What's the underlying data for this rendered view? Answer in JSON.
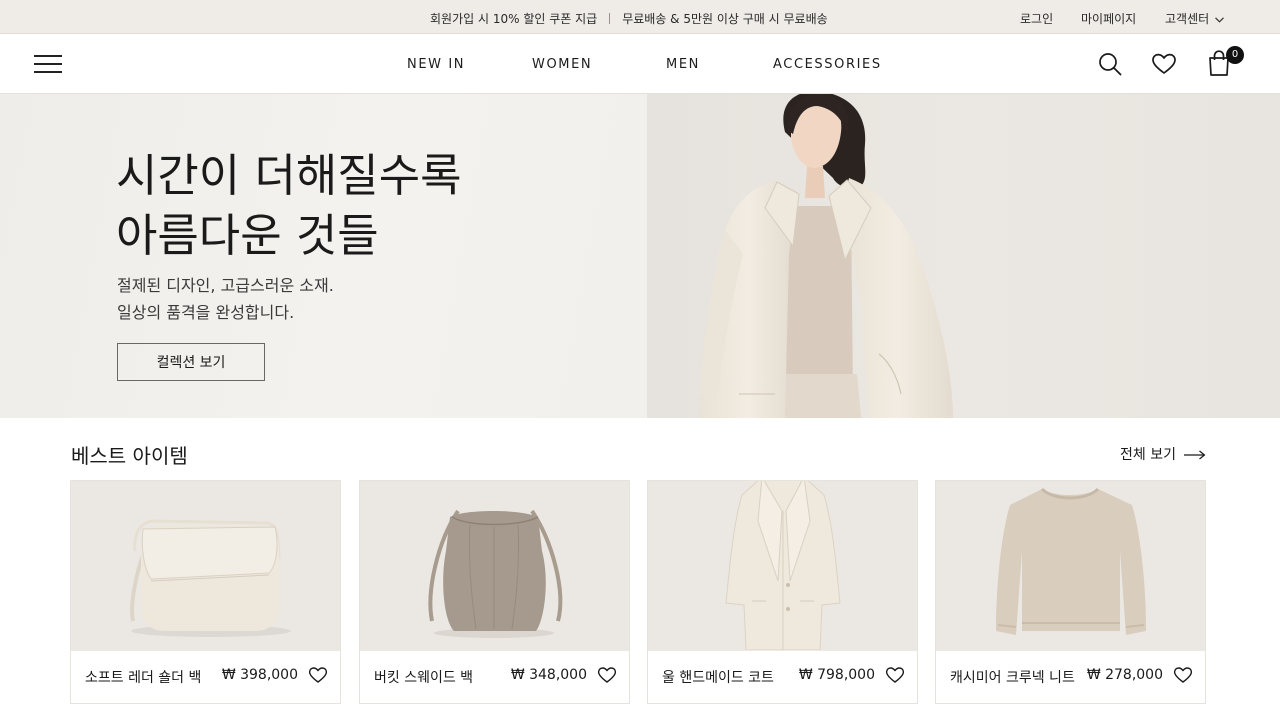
{
  "topbar": {
    "promo_coupon": "회원가입 시 10% 할인 쿠폰 지급",
    "promo_shipping": "무료배송 & 5만원 이상 구매 시 무료배송",
    "login": "로그인",
    "mypage": "마이페이지",
    "customer_center": "고객센터"
  },
  "nav": {
    "items": [
      "NEW IN",
      "WOMEN",
      "MEN",
      "ACCESSORIES"
    ],
    "cart_count": "0"
  },
  "hero": {
    "title_line1": "시간이 더해질수록",
    "title_line2": "아름다운 것들",
    "sub_line1": "절제된 디자인, 고급스러운 소재.",
    "sub_line2": "일상의 품격을 완성합니다.",
    "cta": "컬렉션 보기"
  },
  "best": {
    "title": "베스트 아이템",
    "view_all": "전체 보기",
    "products": [
      {
        "name": "소프트 레더 숄더 백",
        "price": "₩ 398,000",
        "image": "cream-shoulder-bag"
      },
      {
        "name": "버킷 스웨이드 백",
        "price": "₩ 348,000",
        "image": "taupe-bucket-bag"
      },
      {
        "name": "울 핸드메이드 코트",
        "price": "₩ 798,000",
        "image": "ivory-wool-coat"
      },
      {
        "name": "캐시미어 크루넥 니트",
        "price": "₩ 278,000",
        "image": "beige-cashmere-sweater"
      }
    ]
  },
  "colors": {
    "topbar_bg": "#efebe6",
    "hero_bg": "#f2f0ec",
    "text": "#1c1c1c",
    "badge": "#111111"
  }
}
